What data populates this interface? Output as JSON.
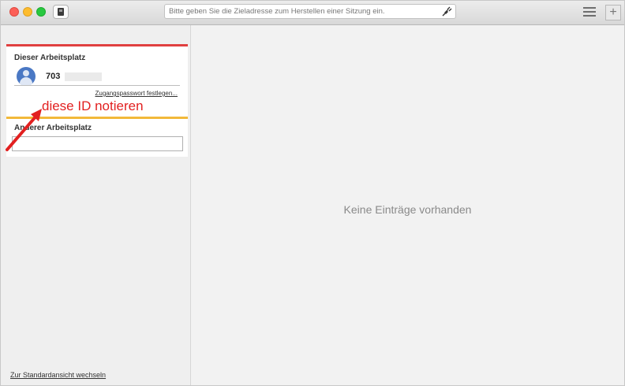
{
  "titlebar": {
    "address_placeholder": "Bitte geben Sie die Zieladresse zum Herstellen einer Sitzung ein.",
    "new_tab_label": "+"
  },
  "sidebar": {
    "this_workplace": {
      "title": "Dieser Arbeitsplatz",
      "id_prefix": "703",
      "set_password_link": "Zugangspasswort festlegen..."
    },
    "other_workplace": {
      "title": "Anderer Arbeitsplatz",
      "input_value": ""
    },
    "footer_link": "Zur Standardansicht wechseln"
  },
  "annotation": {
    "text": "diese ID notieren",
    "color": "#e22020"
  },
  "main": {
    "empty_text": "Keine Einträge vorhanden"
  },
  "colors": {
    "accent_red": "#e04040",
    "accent_yellow": "#f2b93a",
    "avatar_blue": "#4a78c4"
  }
}
